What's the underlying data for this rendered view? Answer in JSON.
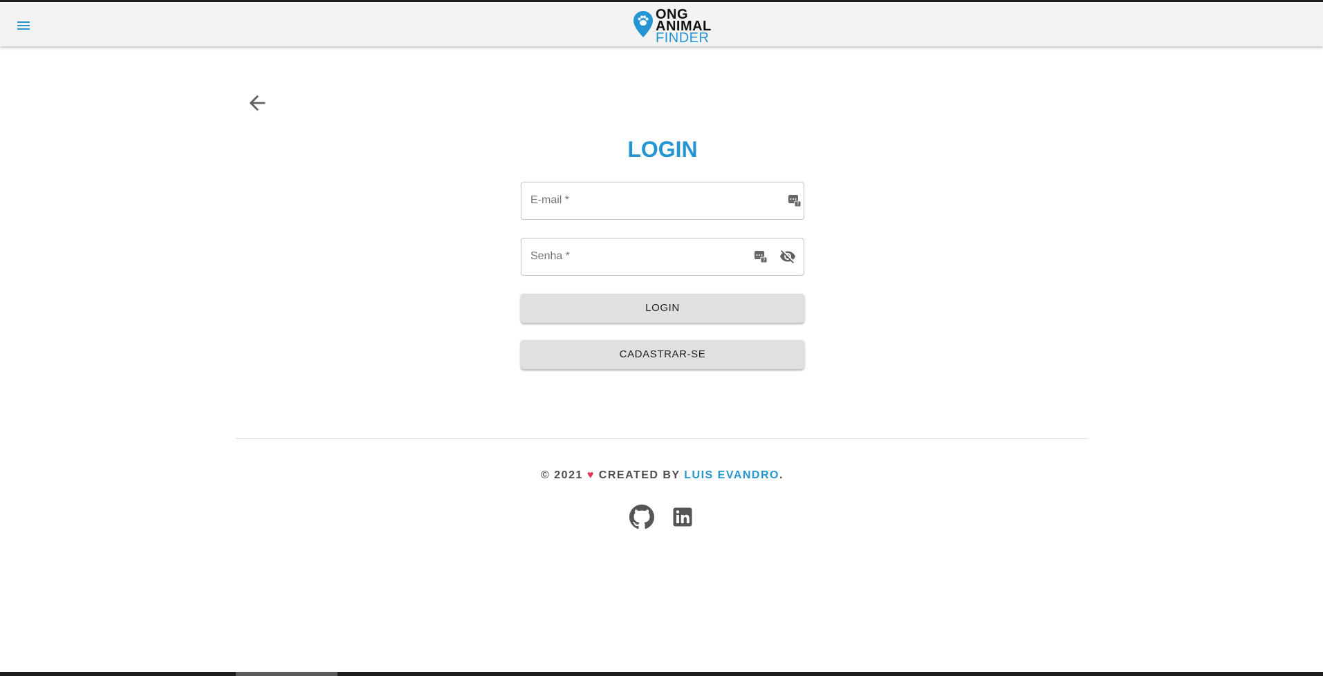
{
  "header": {
    "logo_line1": "ONG",
    "logo_line2": "ANIMAL",
    "logo_line3": "FINDER",
    "icons": {
      "menu": "menu-icon",
      "logo": "location-pin-paw-icon"
    }
  },
  "page": {
    "title": "LOGIN",
    "back_icon": "arrow-back-icon"
  },
  "form": {
    "email_placeholder": "E-mail *",
    "password_placeholder": "Senha *",
    "icons": {
      "autofill": "password-manager-icon",
      "visibility": "visibility-off-icon"
    },
    "login_label": "LOGIN",
    "register_label": "CADASTRAR-SE"
  },
  "footer": {
    "prefix": "© 2021",
    "heart": "♥",
    "created_by": "CREATED BY",
    "author": "LUIS EVANDRO",
    "suffix": ".",
    "social": [
      "github-icon",
      "linkedin-icon"
    ]
  },
  "colors": {
    "accent": "#2594d3",
    "heart": "#e0334f",
    "appbar_bg": "#f3f3f3",
    "button_bg": "#e0e0e0"
  }
}
